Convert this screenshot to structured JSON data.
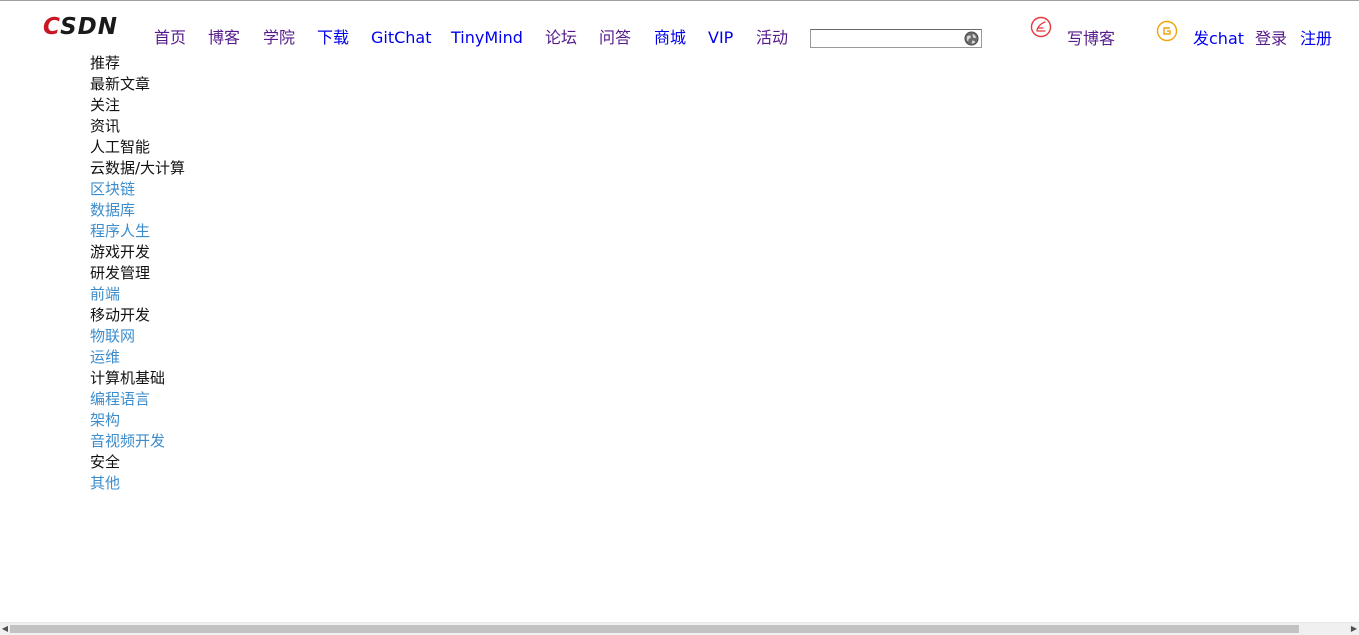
{
  "header": {
    "logo_text_c": "C",
    "logo_text_rest": "SDN",
    "nav": [
      {
        "label": "首页",
        "visited": true
      },
      {
        "label": "博客",
        "visited": true
      },
      {
        "label": "学院",
        "visited": true
      },
      {
        "label": "下载",
        "visited": false
      },
      {
        "label": "GitChat",
        "visited": false
      },
      {
        "label": "TinyMind",
        "visited": false
      },
      {
        "label": "论坛",
        "visited": true
      },
      {
        "label": "问答",
        "visited": true
      },
      {
        "label": "商城",
        "visited": false
      },
      {
        "label": "VIP",
        "visited": false
      },
      {
        "label": "活动",
        "visited": true
      }
    ],
    "search": {
      "value": "",
      "placeholder": ""
    },
    "write_blog_label": "写博客",
    "post_chat_label": "发chat",
    "login_label": "登录",
    "register_label": "注册"
  },
  "sidebar": {
    "items": [
      {
        "label": "推荐",
        "link": false
      },
      {
        "label": "最新文章",
        "link": false
      },
      {
        "label": "关注",
        "link": false
      },
      {
        "label": "资讯",
        "link": false
      },
      {
        "label": "人工智能",
        "link": false
      },
      {
        "label": "云数据/大计算",
        "link": false
      },
      {
        "label": "区块链",
        "link": true
      },
      {
        "label": "数据库",
        "link": true
      },
      {
        "label": "程序人生",
        "link": true
      },
      {
        "label": "游戏开发",
        "link": false
      },
      {
        "label": "研发管理",
        "link": false
      },
      {
        "label": "前端",
        "link": true
      },
      {
        "label": "移动开发",
        "link": false
      },
      {
        "label": "物联网",
        "link": true
      },
      {
        "label": "运维",
        "link": true
      },
      {
        "label": "计算机基础",
        "link": false
      },
      {
        "label": "编程语言",
        "link": true
      },
      {
        "label": "架构",
        "link": true
      },
      {
        "label": "音视频开发",
        "link": true
      },
      {
        "label": "安全",
        "link": false
      },
      {
        "label": "其他",
        "link": true
      }
    ]
  },
  "colors": {
    "brand_red": "#c81623",
    "visited_link": "#551a8b",
    "unvisited_link": "#0000ee",
    "sidebar_link": "#3d8dcc",
    "write_icon": "#e8383d",
    "chat_icon": "#f0a30a"
  },
  "icons": {
    "search": "globe-icon",
    "write": "write-blog-icon",
    "chat": "chat-icon"
  }
}
